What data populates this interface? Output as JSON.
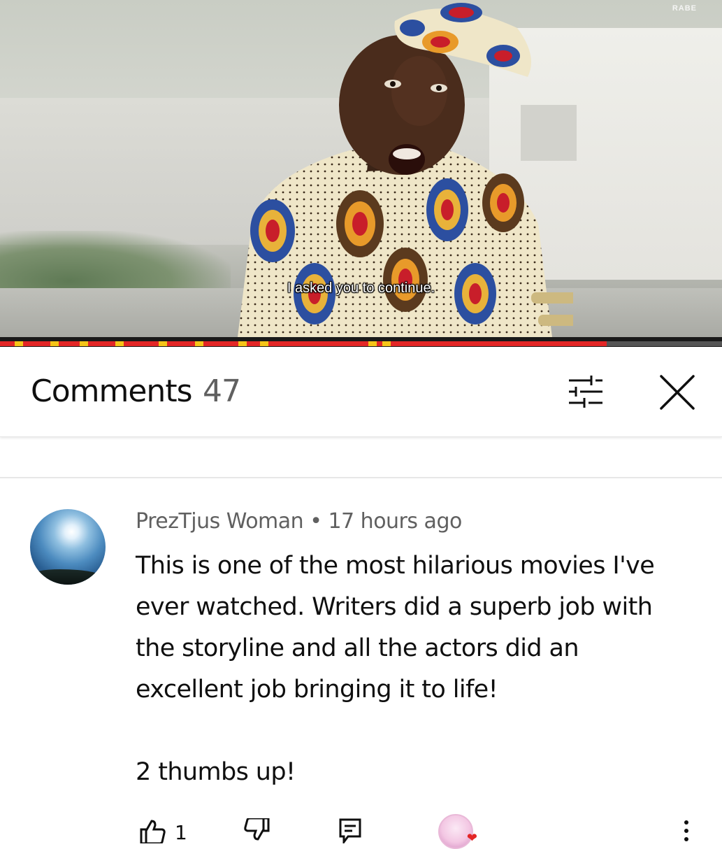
{
  "video": {
    "watermark": "RABE",
    "subtitle": "I asked you to continue.",
    "progress": 0.84,
    "ad_markers": [
      0.02,
      0.07,
      0.11,
      0.16,
      0.22,
      0.27,
      0.33,
      0.36,
      0.51,
      0.53
    ]
  },
  "comments_panel": {
    "title": "Comments",
    "count": "47",
    "filter_icon": "sliders-icon",
    "close_icon": "close-icon"
  },
  "comment": {
    "author": "PrezTjus Woman",
    "separator": "•",
    "time": "17 hours ago",
    "lines": [
      "This is one of the most hilarious movies I've",
      "ever watched. Writers did a superb job with",
      "the storyline and all the actors did an",
      "excellent job bringing it to life!"
    ],
    "closing": "2 thumbs up!",
    "likes": "1"
  },
  "colors": {
    "progress_red": "#e32626",
    "text_primary": "#0f0f0f",
    "text_secondary": "#606060"
  }
}
